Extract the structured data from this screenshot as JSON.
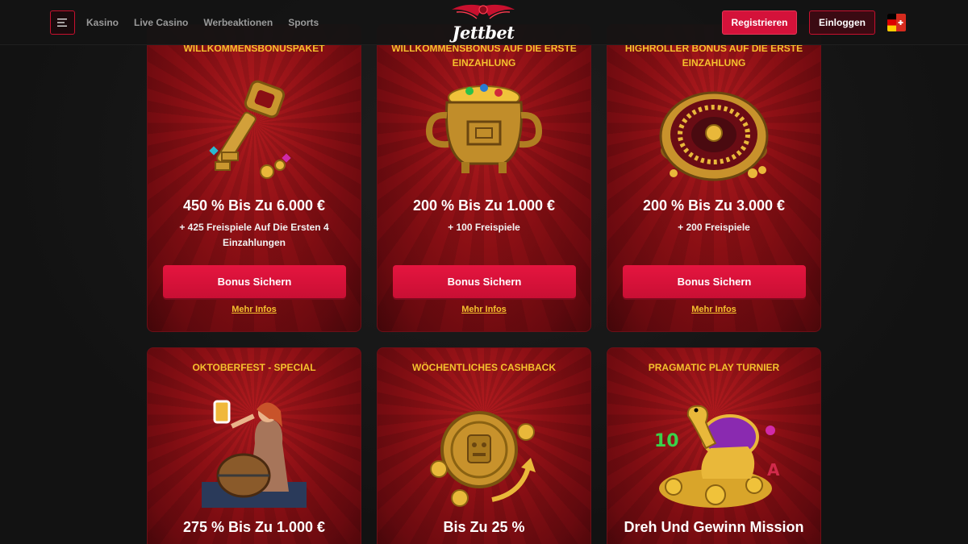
{
  "header": {
    "menu_icon": "hamburger-icon",
    "nav": [
      {
        "label": "Kasino"
      },
      {
        "label": "Live Casino"
      },
      {
        "label": "Werbeaktionen"
      },
      {
        "label": "Sports"
      }
    ],
    "logo_text": "Jettbet",
    "register_label": "Registrieren",
    "login_label": "Einloggen",
    "language_icon": "german-swiss-flag-icon"
  },
  "colors": {
    "accent": "#d4123a",
    "gold": "#f5c12e",
    "card_red": "#8a0f14",
    "background": "#141414"
  },
  "cards": [
    {
      "title": "WILLKOMMENSBONUSPAKET",
      "art": "golden-key-icon",
      "amount": "450 % Bis Zu 6.000 €",
      "sub": "+ 425 Freispiele Auf Die Ersten 4 Einzahlungen",
      "button": "Bonus Sichern",
      "link": "Mehr Infos"
    },
    {
      "title": "WILLKOMMENSBONUS AUF DIE ERSTE EINZAHLUNG",
      "art": "gold-pot-icon",
      "amount": "200 % Bis Zu 1.000 €",
      "sub": "+ 100 Freispiele",
      "button": "Bonus Sichern",
      "link": "Mehr Infos"
    },
    {
      "title": "HIGHROLLER BONUS AUF DIE ERSTE EINZAHLUNG",
      "art": "roulette-wheel-icon",
      "amount": "200 % Bis Zu 3.000 €",
      "sub": "+ 200 Freispiele",
      "button": "Bonus Sichern",
      "link": "Mehr Infos"
    },
    {
      "title": "OKTOBERFEST - SPECIAL",
      "art": "beer-barrel-woman-icon",
      "amount": "275 % Bis Zu 1.000 €"
    },
    {
      "title": "WÖCHENTLICHES CASHBACK",
      "art": "golden-coin-cashback-icon",
      "amount": "Bis Zu 25 %"
    },
    {
      "title": "PRAGMATIC PLAY TURNIER",
      "art": "golden-turtle-icon",
      "amount": "Dreh Und Gewinn Mission"
    }
  ]
}
